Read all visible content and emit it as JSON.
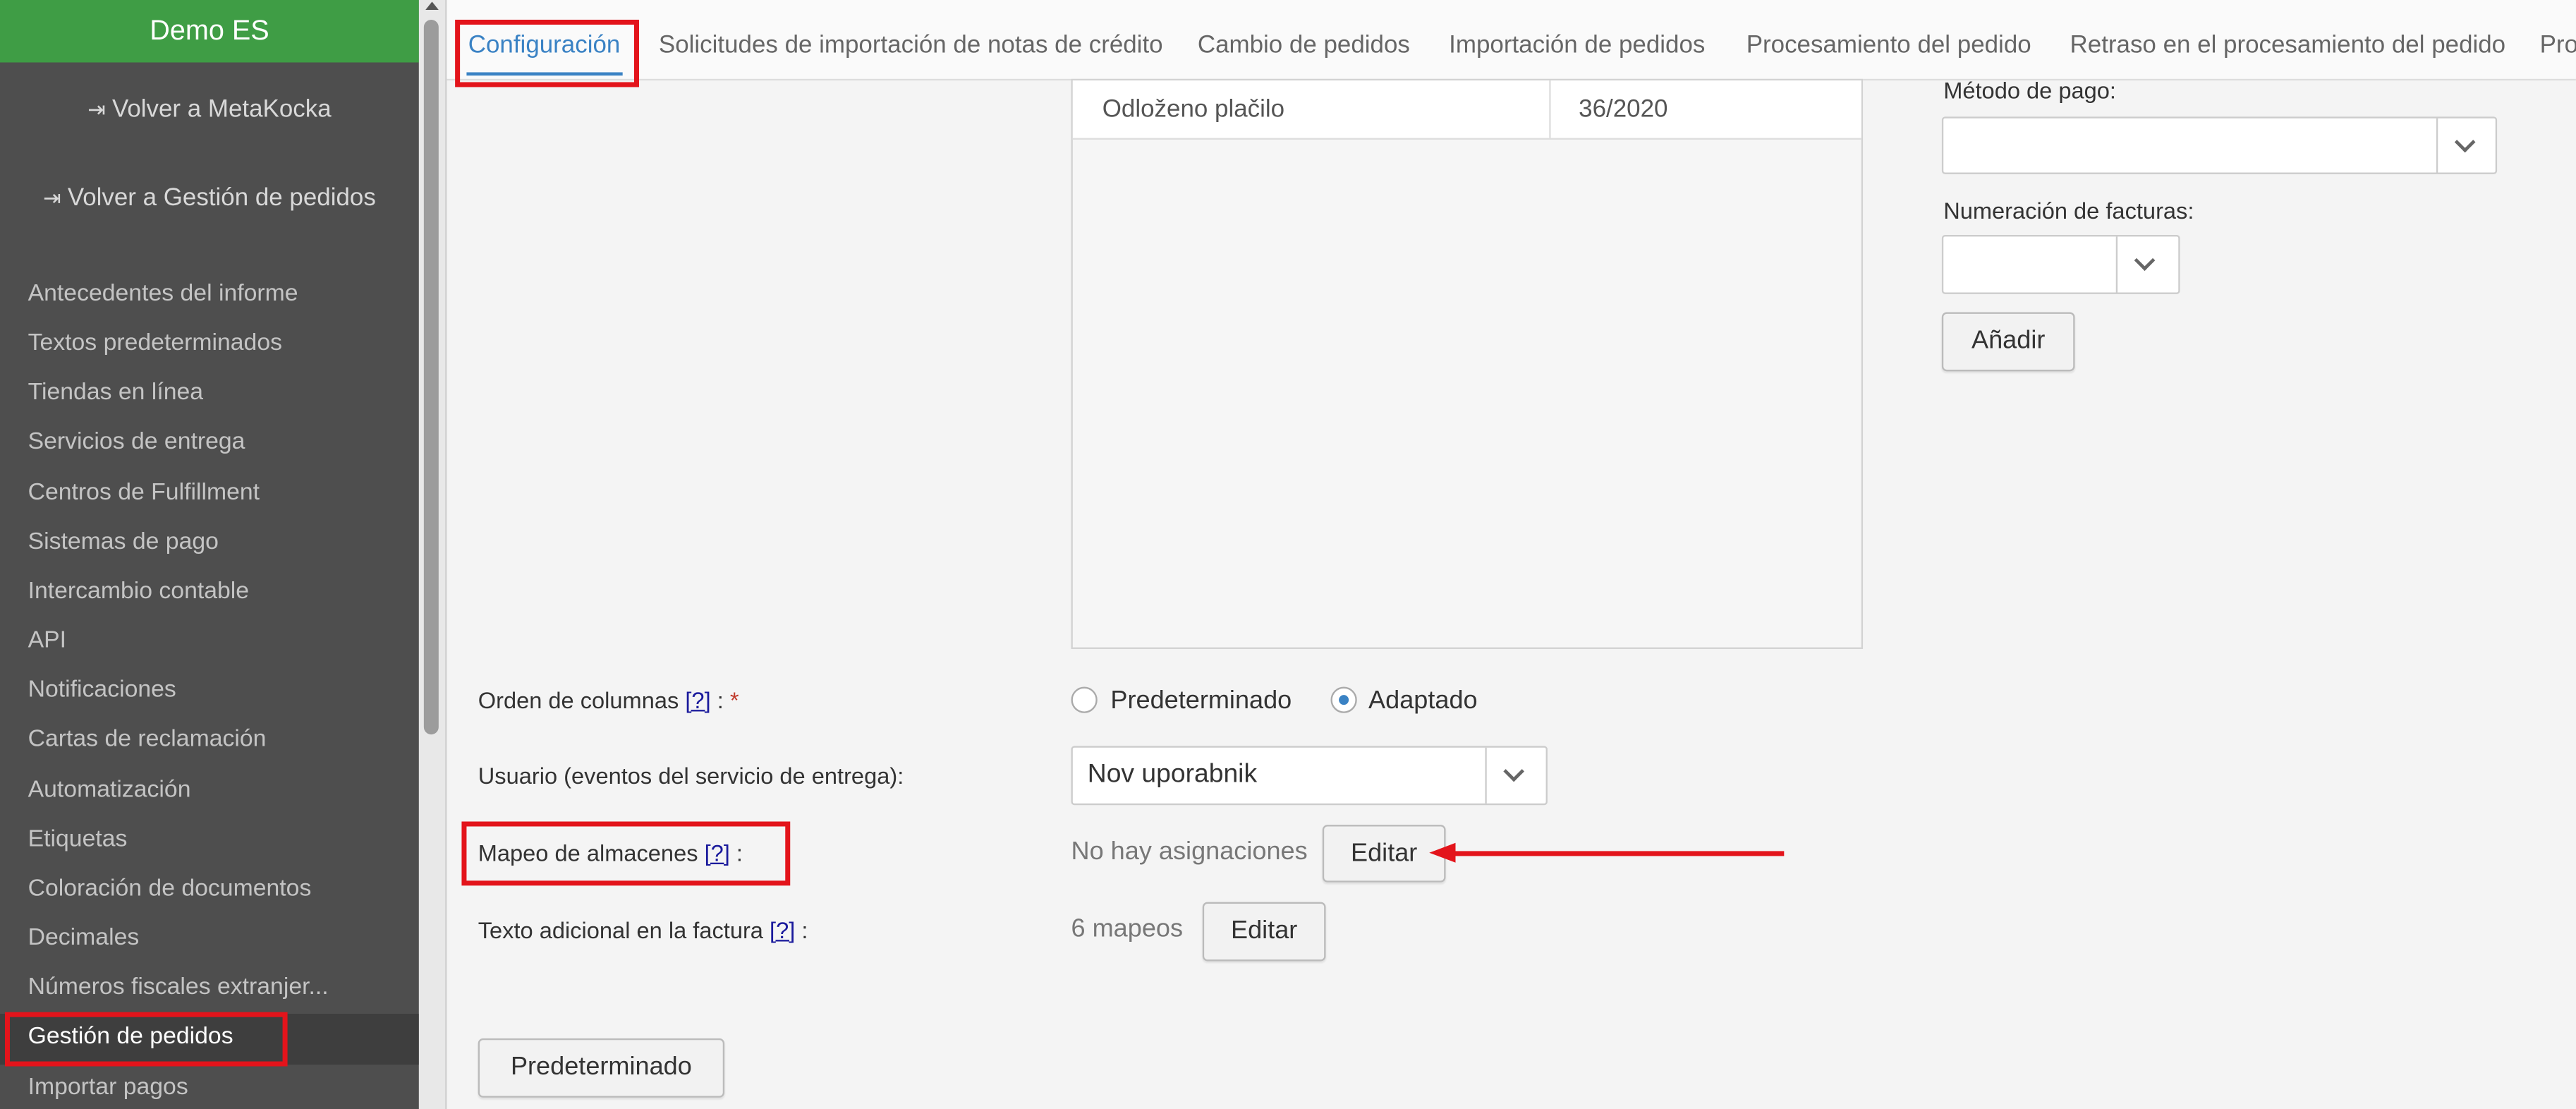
{
  "sidebar": {
    "brand": "Demo ES",
    "back_links": [
      "Volver a MetaKocka",
      "Volver a Gestión de pedidos"
    ],
    "items": [
      "Antecedentes del informe",
      "Textos predeterminados",
      "Tiendas en línea",
      "Servicios de entrega",
      "Centros de Fulfillment",
      "Sistemas de pago",
      "Intercambio contable",
      "API",
      "Notificaciones",
      "Cartas de reclamación",
      "Automatización",
      "Etiquetas",
      "Coloración de documentos",
      "Decimales",
      "Números fiscales extranjer...",
      "Gestión de pedidos",
      "Importar pagos"
    ]
  },
  "tabs": [
    "Configuración",
    "Solicitudes de importación de notas de crédito",
    "Cambio de pedidos",
    "Importación de pedidos",
    "Procesamiento del pedido",
    "Retraso en el procesamiento del pedido",
    "Pro"
  ],
  "table": {
    "cells": [
      "Odloženo plačilo",
      "36/2020"
    ]
  },
  "form": {
    "column_order": {
      "label": "Orden de columnas",
      "help": "[?]",
      "colon": " :",
      "required": " *",
      "options": [
        "Predeterminado",
        "Adaptado"
      ]
    },
    "user": {
      "label": "Usuario (eventos del servicio de entrega):",
      "value": "Nov uporabnik"
    },
    "warehouse": {
      "label": "Mapeo de almacenes",
      "help": "[?]",
      "colon": " :",
      "status": "No hay asignaciones",
      "button": "Editar"
    },
    "extra_text": {
      "label": "Texto adicional en la factura",
      "help": "[?]",
      "colon": " :",
      "status": "6 mapeos",
      "button": "Editar"
    },
    "default_button": "Predeterminado"
  },
  "right_panel": {
    "payment_method_label": "Método de pago:",
    "numbering_label": "Numeración de facturas:",
    "add_button": "Añadir"
  },
  "colors": {
    "brand": "#3f9d45",
    "sidebar": "#4e4e4e",
    "tab_active": "#3a82c4",
    "highlight": "#e3141b"
  }
}
